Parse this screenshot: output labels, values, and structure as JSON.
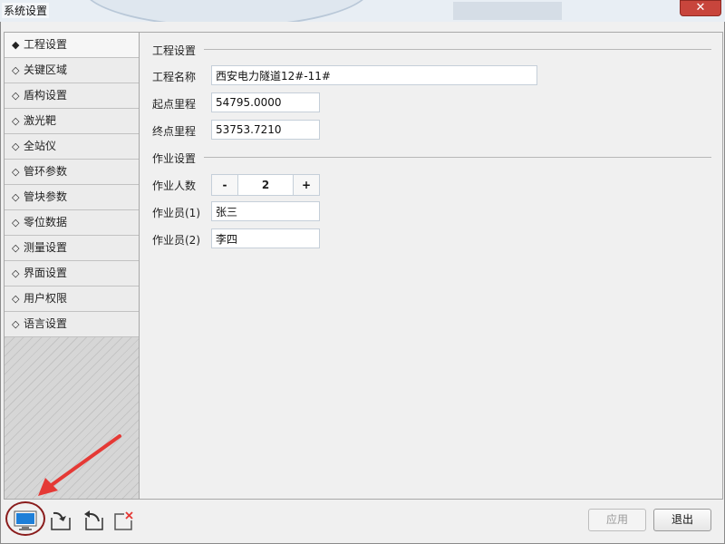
{
  "window": {
    "title": "系统设置",
    "close_label": "✕"
  },
  "sidebar": {
    "items": [
      {
        "bullet": "◆",
        "label": "工程设置"
      },
      {
        "bullet": "◇",
        "label": "关键区域"
      },
      {
        "bullet": "◇",
        "label": "盾构设置"
      },
      {
        "bullet": "◇",
        "label": "激光靶"
      },
      {
        "bullet": "◇",
        "label": "全站仪"
      },
      {
        "bullet": "◇",
        "label": "管环参数"
      },
      {
        "bullet": "◇",
        "label": "管块参数"
      },
      {
        "bullet": "◇",
        "label": "零位数据"
      },
      {
        "bullet": "◇",
        "label": "测量设置"
      },
      {
        "bullet": "◇",
        "label": "界面设置"
      },
      {
        "bullet": "◇",
        "label": "用户权限"
      },
      {
        "bullet": "◇",
        "label": "语言设置"
      }
    ]
  },
  "project": {
    "section_title": "工程设置",
    "name_label": "工程名称",
    "name_value": "西安电力隧道12#-11#",
    "start_label": "起点里程",
    "start_value": "54795.0000",
    "end_label": "终点里程",
    "end_value": "53753.7210"
  },
  "work": {
    "section_title": "作业设置",
    "count_label": "作业人数",
    "minus": "-",
    "count_value": "2",
    "plus": "+",
    "worker1_label": "作业员(1)",
    "worker1_value": "张三",
    "worker2_label": "作业员(2)",
    "worker2_value": "李四"
  },
  "footer": {
    "apply_label": "应用",
    "exit_label": "退出"
  },
  "colors": {
    "annotation": "#e53935",
    "highlight_ring": "#8a1c1c",
    "monitor_icon": "#1e7fd8",
    "delete_mark": "#e53935"
  }
}
